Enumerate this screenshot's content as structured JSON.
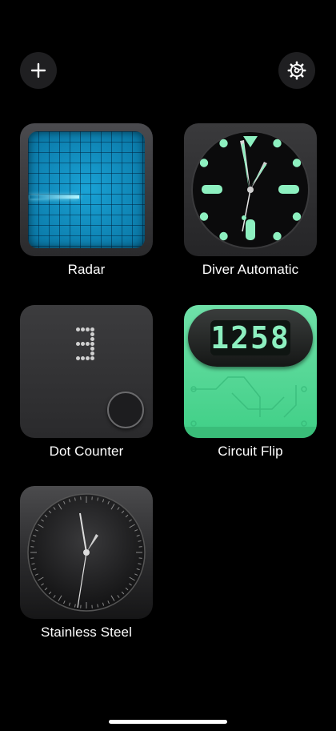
{
  "toolbar": {
    "add_icon": "plus-icon",
    "settings_icon": "gear-icon"
  },
  "widgets": [
    {
      "label": "Radar",
      "icon": "radar-screen"
    },
    {
      "label": "Diver Automatic",
      "icon": "diver-watch-face"
    },
    {
      "label": "Dot Counter",
      "icon": "dot-matrix-counter",
      "display_value": "3"
    },
    {
      "label": "Circuit Flip",
      "icon": "flip-clock",
      "display_value": "1258"
    },
    {
      "label": "Stainless Steel",
      "icon": "analog-watch-face"
    }
  ],
  "colors": {
    "background": "#000000",
    "radar_blue": "#0d86b8",
    "lume_green": "#8df0c0",
    "circuit_green": "#4fd692"
  }
}
